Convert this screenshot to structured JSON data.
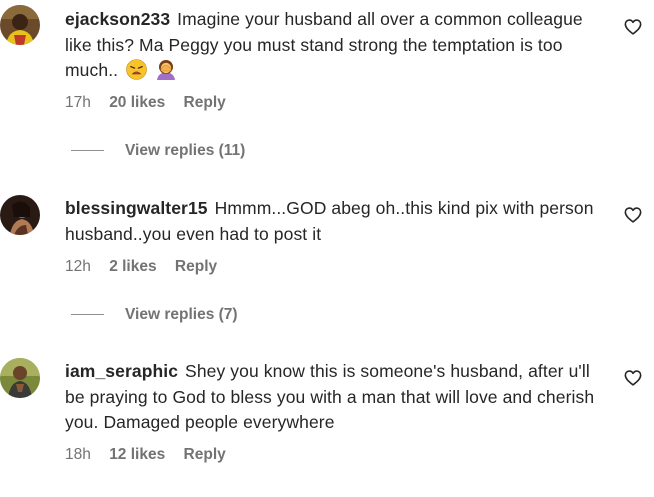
{
  "comments": [
    {
      "username": "ejackson233",
      "text": "Imagine your husband all over a common colleague like this? Ma Peggy you must stand strong the temptation is too much..",
      "time": "17h",
      "likes": "20 likes",
      "reply_label": "Reply",
      "view_replies": "View replies (11)"
    },
    {
      "username": "blessingwalter15",
      "text": "Hmmm...GOD abeg oh..this kind pix with person husband..you even had to post it",
      "time": "12h",
      "likes": "2 likes",
      "reply_label": "Reply",
      "view_replies": "View replies (7)"
    },
    {
      "username": "iam_seraphic",
      "text": "Shey you know this is someone's husband, after u'll be praying to God to bless you with a man that will love and cherish you. Damaged people everywhere",
      "time": "18h",
      "likes": "12 likes",
      "reply_label": "Reply"
    }
  ],
  "icons": {
    "like": "heart-outline-icon",
    "emoji_1": "weary-face-emoji",
    "emoji_2": "person-facepalming-emoji"
  },
  "colors": {
    "text": "#262626",
    "secondary": "#737373",
    "background": "#ffffff"
  }
}
